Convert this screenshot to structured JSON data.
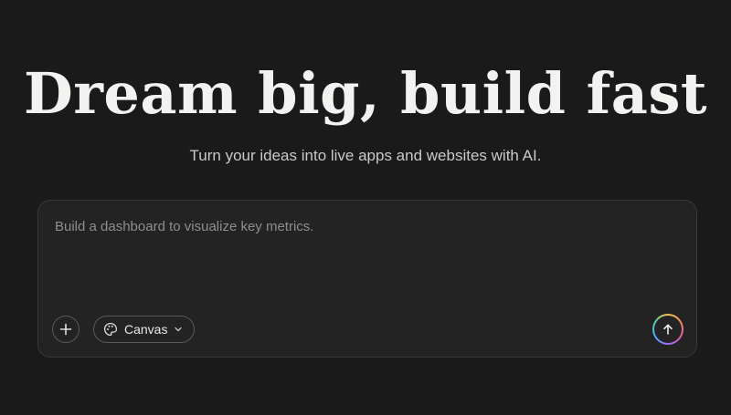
{
  "hero": {
    "title": "Dream big, build fast",
    "subtitle": "Turn your ideas into live apps and websites with AI."
  },
  "prompt": {
    "value": "",
    "placeholder": "Build a dashboard to visualize key metrics."
  },
  "toolbar": {
    "add_icon": "plus-icon",
    "mode_icon": "palette-icon",
    "mode_label": "Canvas",
    "mode_dropdown_icon": "chevron-down-icon",
    "send_icon": "arrow-up-icon"
  },
  "colors": {
    "background": "#1a1a1a",
    "panel": "#232323",
    "panel_border": "#383838",
    "title_text": "#f2f2f0",
    "placeholder_text": "#8e8e8e"
  }
}
